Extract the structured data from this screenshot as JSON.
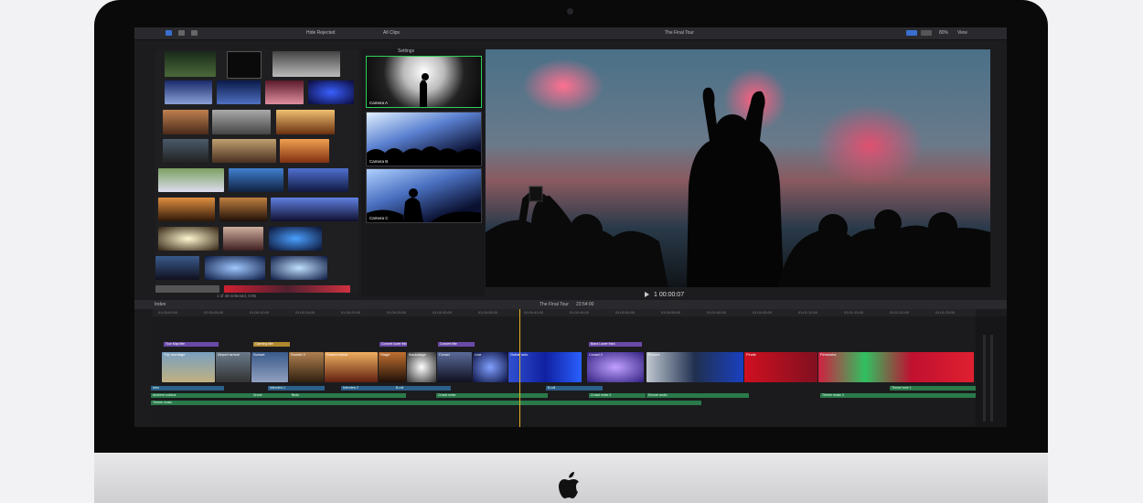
{
  "toolbar": {
    "library": "Hide Rejected",
    "event": "All Clips",
    "project": "The Final Tour",
    "zoom": "80%",
    "view": "View",
    "settings": "Settings"
  },
  "browser": {
    "status": "1 of 48 selected, 0:05"
  },
  "angles": [
    "Camera A",
    "Camera B",
    "Camera C"
  ],
  "viewer": {
    "timecode": "1 00:00:07"
  },
  "timeline": {
    "index": "Index",
    "project": "The Final Tour",
    "duration": "23:54:00",
    "ruler": [
      "01:00:00:00",
      "01:00:05:00",
      "01:00:10:00",
      "01:00:15:00",
      "01:00:20:00",
      "01:00:25:00",
      "01:00:30:00",
      "01:00:35:00",
      "01:00:40:00",
      "01:00:45:00",
      "01:00:50:00",
      "01:00:55:00",
      "01:01:00:00",
      "01:01:05:00",
      "01:01:10:00",
      "01:01:15:00",
      "01:01:20:00",
      "01:01:25:00"
    ],
    "titles": [
      "Tour Map title",
      "Opening title",
      "Concert lower third",
      "Concert title",
      "Band Lower third"
    ],
    "clips": [
      "Trip montage",
      "Airport arrival",
      "Sunset",
      "Sunset 2",
      "Sound check",
      "Stage",
      "Backstage",
      "Crowd",
      "Live",
      "Guitar solo",
      "Crowd 2",
      "Encore",
      "Finale",
      "Fireworks"
    ],
    "audio_a": [
      "Intro",
      "Interview 1",
      "Interview 2",
      "B-roll",
      "B-roll",
      "Theme tune 1"
    ],
    "audio_b": [
      "Ambient outdoor",
      "Drone",
      "Birds",
      "Crowd noise",
      "Crowd noise 2",
      "Encore audio",
      "Theme music 2"
    ],
    "audio_c": [
      "Theme music"
    ]
  },
  "colors": {
    "accent": "#3a6fd0",
    "active_angle": "#2fd05a",
    "playhead": "#e8b020"
  }
}
